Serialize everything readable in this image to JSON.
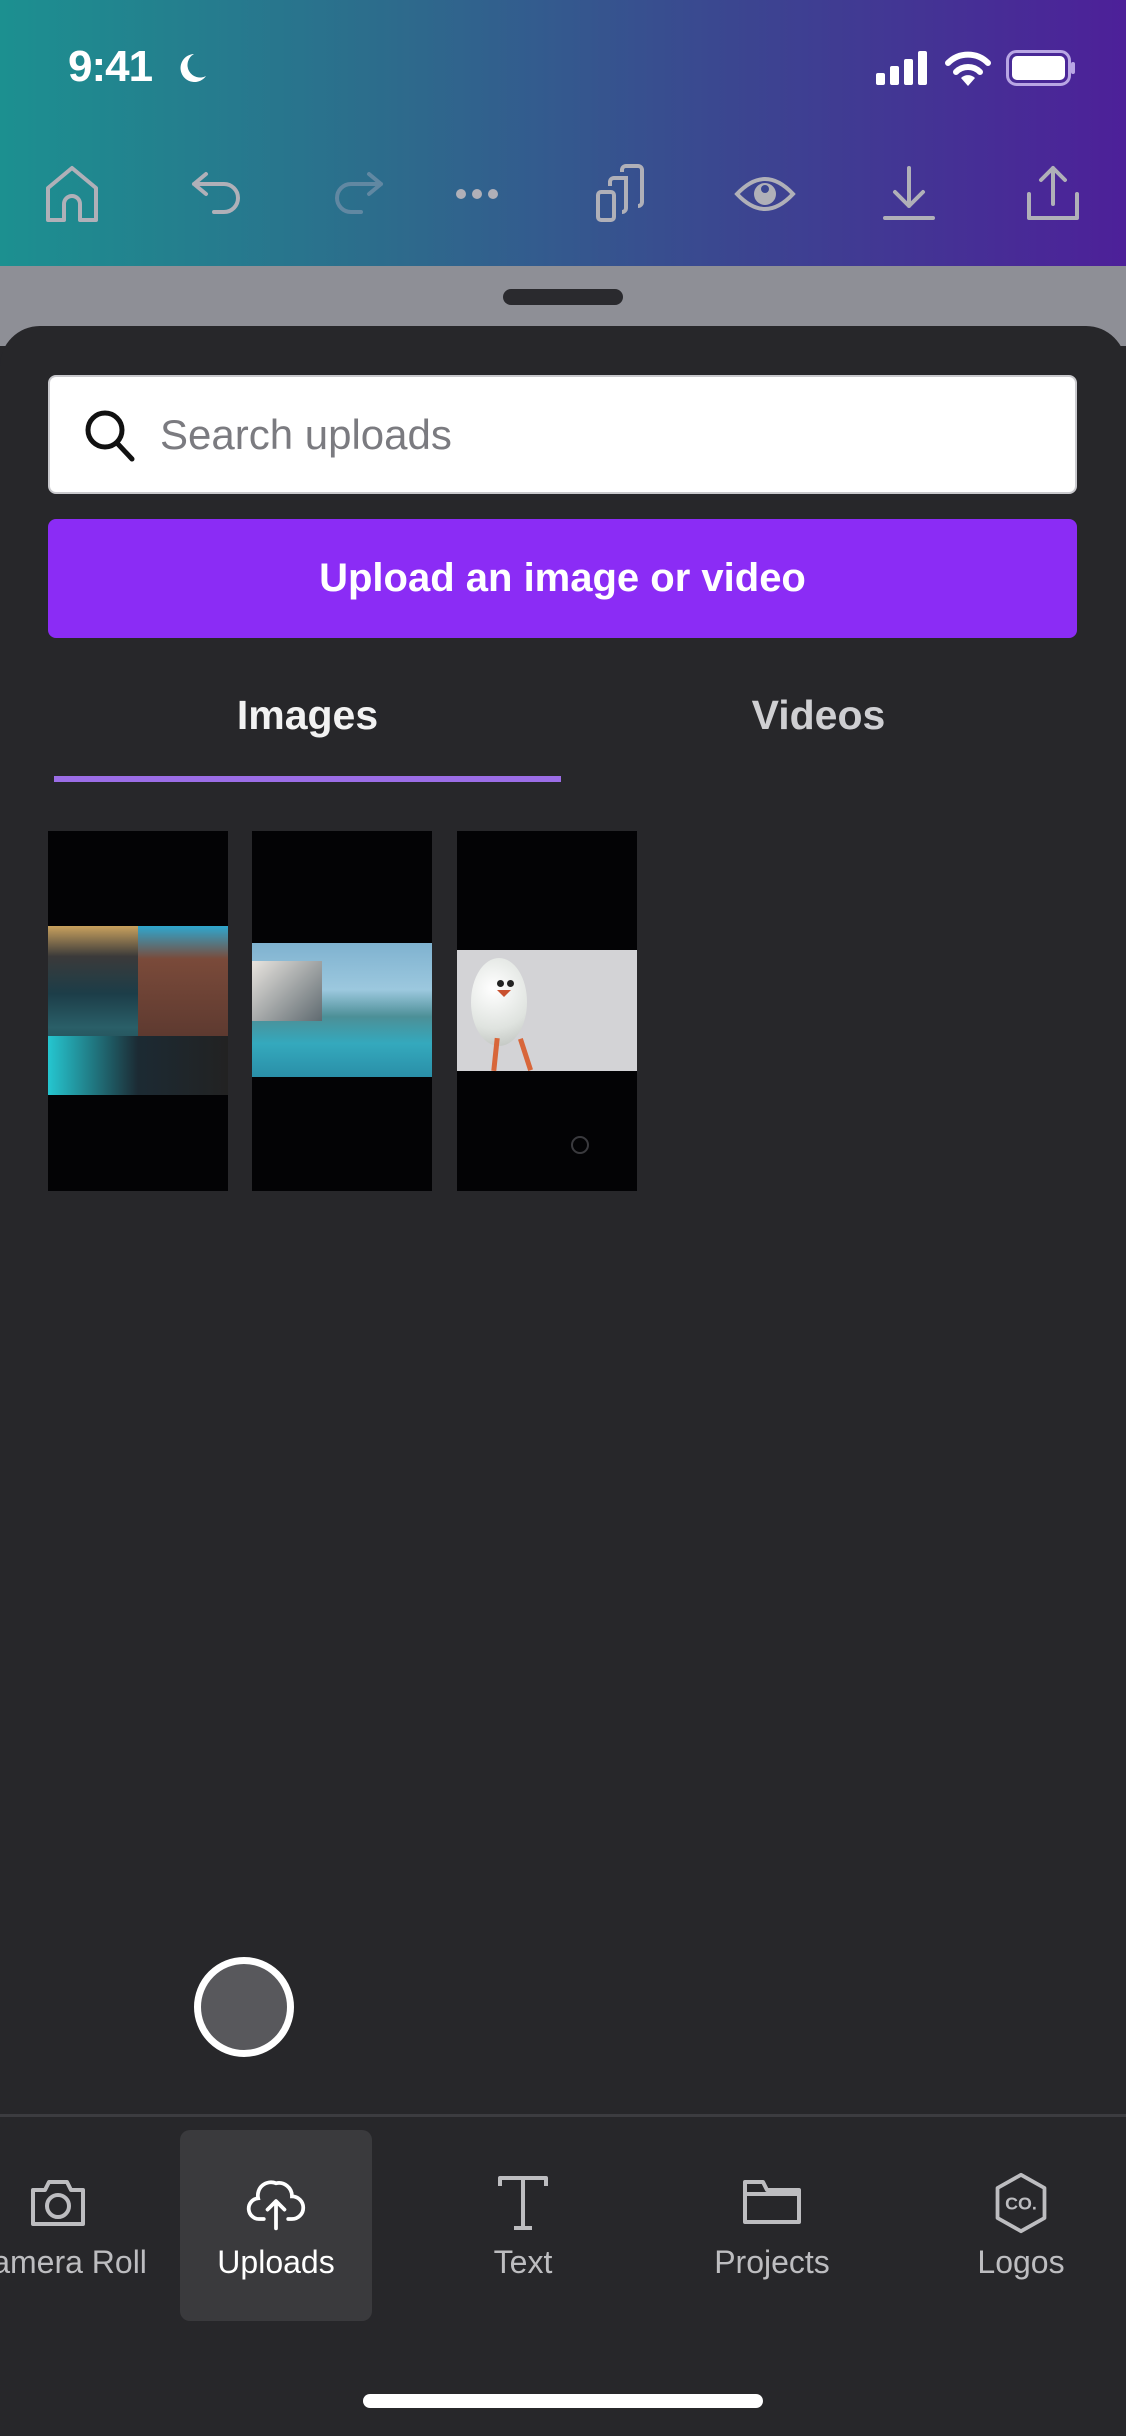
{
  "status_bar": {
    "time": "9:41",
    "focus_icon": "moon-icon",
    "icons": [
      "cellular-signal-icon",
      "wifi-icon",
      "battery-icon"
    ]
  },
  "toolbar": {
    "items": [
      {
        "name": "home",
        "icon": "home-icon",
        "enabled": true
      },
      {
        "name": "undo",
        "icon": "undo-icon",
        "enabled": true
      },
      {
        "name": "redo",
        "icon": "redo-icon",
        "enabled": false
      },
      {
        "name": "more",
        "icon": "more-icon",
        "enabled": true
      },
      {
        "name": "pages",
        "icon": "pages-icon",
        "enabled": true
      },
      {
        "name": "preview",
        "icon": "eye-icon",
        "enabled": true
      },
      {
        "name": "download",
        "icon": "download-icon",
        "enabled": true
      },
      {
        "name": "share",
        "icon": "share-icon",
        "enabled": true
      }
    ],
    "gradient": [
      "#1c9090",
      "#4d2099"
    ]
  },
  "search": {
    "placeholder": "Search uploads",
    "value": ""
  },
  "upload_button": {
    "label": "Upload an image or video",
    "color": "#8b2cf5"
  },
  "tabs": {
    "items": [
      {
        "label": "Images",
        "active": true
      },
      {
        "label": "Videos",
        "active": false
      }
    ],
    "indicator_color": "#9b6de6"
  },
  "uploads": {
    "images": [
      {
        "description": "Street storefront with neon 'wild at heart' sign and flowers"
      },
      {
        "description": "Infinity pool overlooking landscape"
      },
      {
        "description": "3D egg character with legs"
      }
    ]
  },
  "bottom_nav": {
    "items": [
      {
        "label": "Camera Roll",
        "icon": "camera-icon",
        "active": false
      },
      {
        "label": "Uploads",
        "icon": "cloud-upload-icon",
        "active": true
      },
      {
        "label": "Text",
        "icon": "text-icon",
        "active": false
      },
      {
        "label": "Projects",
        "icon": "folder-icon",
        "active": false
      },
      {
        "label": "Logos",
        "icon": "logo-hexagon-icon",
        "active": false
      }
    ],
    "logos_badge_text": "CO."
  }
}
